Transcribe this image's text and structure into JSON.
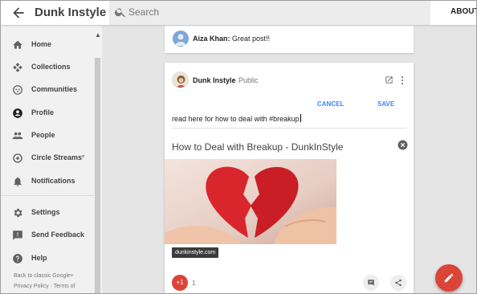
{
  "header": {
    "app_title": "Dunk Instyle",
    "search_placeholder": "Search",
    "about_label": "ABOUT"
  },
  "sidebar": {
    "items": [
      {
        "label": "Home",
        "icon": "home-icon"
      },
      {
        "label": "Collections",
        "icon": "collections-icon"
      },
      {
        "label": "Communities",
        "icon": "communities-icon"
      },
      {
        "label": "Profile",
        "icon": "profile-icon"
      },
      {
        "label": "People",
        "icon": "people-icon"
      },
      {
        "label": "Circle Streams",
        "icon": "circle-streams-icon"
      },
      {
        "label": "Notifications",
        "icon": "notifications-icon"
      },
      {
        "label": "Settings",
        "icon": "settings-icon"
      },
      {
        "label": "Send Feedback",
        "icon": "feedback-icon"
      },
      {
        "label": "Help",
        "icon": "help-icon"
      }
    ],
    "footer_classic": "Back to classic Google+",
    "footer_links": "Privacy Policy · Terms of"
  },
  "comment": {
    "author": "Aiza Khan:",
    "text": " Great post!!"
  },
  "post": {
    "author": "Dunk Instyle",
    "visibility": "Public",
    "cancel_label": "CANCEL",
    "save_label": "SAVE",
    "edit_text": "read here for how to deal with #breakup",
    "link_title": "How to Deal with Breakup - DunkInStyle",
    "domain": "dunkinstyle.com",
    "plus_one_label": "+1",
    "plus_one_count": "1"
  },
  "colors": {
    "accent_blue": "#4285f4",
    "google_red": "#db4437"
  }
}
